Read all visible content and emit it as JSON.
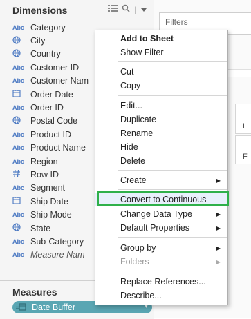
{
  "dimensions": {
    "title": "Dimensions",
    "fields": [
      {
        "type": "Abc",
        "name": "Category"
      },
      {
        "type": "globe",
        "name": "City"
      },
      {
        "type": "globe",
        "name": "Country"
      },
      {
        "type": "Abc",
        "name": "Customer ID"
      },
      {
        "type": "Abc",
        "name": "Customer Nam"
      },
      {
        "type": "cal",
        "name": "Order Date"
      },
      {
        "type": "Abc",
        "name": "Order ID"
      },
      {
        "type": "globe",
        "name": "Postal Code"
      },
      {
        "type": "Abc",
        "name": "Product ID"
      },
      {
        "type": "Abc",
        "name": "Product Name"
      },
      {
        "type": "Abc",
        "name": "Region"
      },
      {
        "type": "hash",
        "name": "Row ID"
      },
      {
        "type": "Abc",
        "name": "Segment"
      },
      {
        "type": "cal",
        "name": "Ship Date"
      },
      {
        "type": "Abc",
        "name": "Ship Mode"
      },
      {
        "type": "globe",
        "name": "State"
      },
      {
        "type": "Abc",
        "name": "Sub-Category"
      },
      {
        "type": "Abc",
        "name": "Measure Nam"
      }
    ],
    "abc_label": "Abc"
  },
  "measures": {
    "title": "Measures",
    "selected_pill": "Date Buffer"
  },
  "workspace": {
    "filters_label": "Filters",
    "card_letters": [
      "L",
      "F"
    ]
  },
  "context_menu": {
    "add_to_sheet": "Add to Sheet",
    "show_filter": "Show Filter",
    "cut": "Cut",
    "copy": "Copy",
    "edit": "Edit...",
    "duplicate": "Duplicate",
    "rename": "Rename",
    "hide": "Hide",
    "delete": "Delete",
    "create": "Create",
    "convert_to_continuous": "Convert to Continuous",
    "change_data_type": "Change Data Type",
    "default_properties": "Default Properties",
    "group_by": "Group by",
    "folders": "Folders",
    "replace_references": "Replace References...",
    "describe": "Describe..."
  },
  "colors": {
    "highlight_box": "#2fb04a",
    "pill": "#5aa6b3",
    "field_icon": "#4a78c2"
  }
}
